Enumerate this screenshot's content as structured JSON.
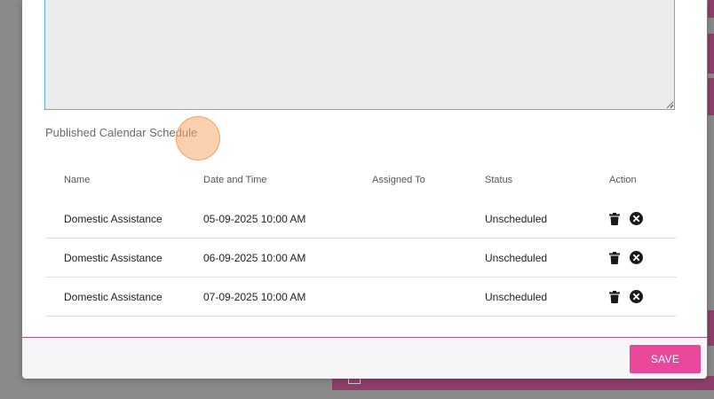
{
  "section": {
    "title": "Published Calendar Schedule"
  },
  "table": {
    "headers": {
      "name": "Name",
      "date": "Date and Time",
      "assigned": "Assigned To",
      "status": "Status",
      "action": "Action"
    },
    "rows": [
      {
        "name": "Domestic Assistance",
        "date": "05-09-2025 10:00 AM",
        "assigned": "",
        "status": "Unscheduled"
      },
      {
        "name": "Domestic Assistance",
        "date": "06-09-2025 10:00 AM",
        "assigned": "",
        "status": "Unscheduled"
      },
      {
        "name": "Domestic Assistance",
        "date": "07-09-2025 10:00 AM",
        "assigned": "",
        "status": "Unscheduled"
      }
    ]
  },
  "icons": {
    "delete": "trash-icon",
    "cancel": "close-circle-icon"
  },
  "footer": {
    "save_label": "SAVE"
  },
  "colors": {
    "accent": "#e8479a",
    "link": "#c2418f",
    "focus_border": "#5fb0e8"
  }
}
